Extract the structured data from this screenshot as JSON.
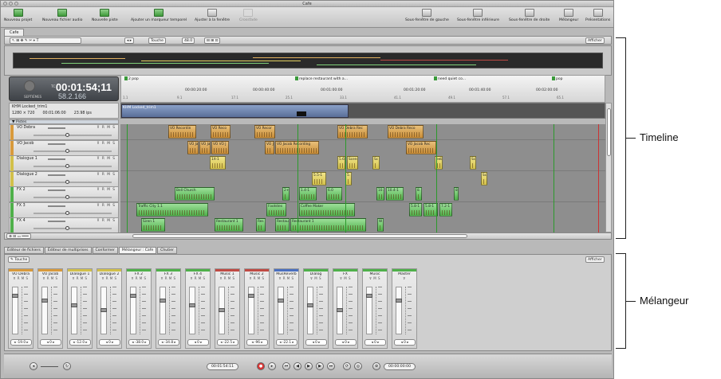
{
  "window": {
    "title": "Cafe"
  },
  "toolbar": {
    "buttons": [
      "Nouveau projet",
      "Nouveau fichier audio",
      "Nouvelle piste",
      "Ajouter un marqueur temporel",
      "Ajuster à la fenêtre",
      "Crossfade"
    ],
    "right_buttons": [
      "Sous-fenêtre de gauche",
      "Sous-fenêtre inférieure",
      "Sous-fenêtre de droite",
      "Mélangeur",
      "Présentations"
    ]
  },
  "project_tab": "Cafe",
  "project_toolbar": {
    "mode": "Touche",
    "zoom": "48.0",
    "afficher": "Afficher"
  },
  "timecode": {
    "tc_label": "TC",
    "main": "00:01:54;11",
    "sub_label": "SEPTIÈMES",
    "sub": "58.2.166"
  },
  "markers": [
    "2 pop",
    "replace restaurant with a...",
    "need quiet co...",
    "pop"
  ],
  "ruler_ticks": [
    "00:00:20:00",
    "00:00:40:00",
    "00:01:00:00",
    "00:01:20:00",
    "00:01:40:00",
    "00:02:00:00"
  ],
  "ruler_ticks2": [
    "1.1",
    "9.1",
    "17.1",
    "25.1",
    "33.1",
    "41.1",
    "49.1",
    "57.1",
    "65.1"
  ],
  "video": {
    "name": "KHM Locked_trim1",
    "size": "1280 × 720",
    "duration": "00:01:06:00",
    "fps": "23.98 ips",
    "clip": "KHM Locked_trim1"
  },
  "pistes_label": "Pistes",
  "tracks": [
    {
      "name": "VO Debra",
      "color": "#d89a3c",
      "clips": [
        [
          "VO Recordin",
          "o",
          60,
          35
        ],
        [
          "VO Reco",
          "o",
          113,
          25
        ],
        [
          "VO Recor",
          "o",
          168,
          26
        ],
        [
          "VO Debra Rec",
          "o",
          272,
          38
        ],
        [
          "VO Debra Reco",
          "o",
          335,
          45
        ]
      ]
    },
    {
      "name": "VO Jacob",
      "color": "#d89a3c",
      "clips": [
        [
          "VO Jac",
          "o",
          84,
          14
        ],
        [
          "VO Jac",
          "o",
          99,
          14
        ],
        [
          "VO VO J",
          "o",
          114,
          22
        ],
        [
          "VO J",
          "o",
          181,
          12
        ],
        [
          "VO Jacob Recording",
          "o",
          194,
          55
        ],
        [
          "VO Jacob Rec",
          "o",
          358,
          38
        ]
      ]
    },
    {
      "name": "Dialogue 1",
      "color": "#d2c04a",
      "clips": [
        [
          "1X-1",
          "y",
          112,
          20
        ],
        [
          "5.6-1",
          "y",
          272,
          10
        ],
        [
          "Scene",
          "y",
          284,
          14
        ],
        [
          "Sc",
          "y",
          316,
          9
        ],
        [
          "eeb",
          "y",
          394,
          10
        ],
        [
          "Sc",
          "y",
          438,
          8
        ]
      ]
    },
    {
      "name": "Dialogue 2",
      "color": "#d2c04a",
      "clips": [
        [
          "5.5-1",
          "y",
          240,
          18
        ],
        [
          "5.",
          "y",
          282,
          8
        ],
        [
          "Sc",
          "y",
          452,
          8
        ]
      ]
    },
    {
      "name": "FX 2",
      "color": "#4fb04a",
      "clips": [
        [
          "Bell Church",
          "g",
          68,
          50
        ],
        [
          "2+",
          "g",
          203,
          9
        ],
        [
          "1.4-1",
          "g",
          224,
          22
        ],
        [
          "6.0",
          "g",
          258,
          20
        ],
        [
          "10.4",
          "g",
          321,
          10
        ],
        [
          "10.4-1",
          "g",
          333,
          22
        ],
        [
          "8.",
          "g",
          370,
          8
        ],
        [
          "8.",
          "g",
          418,
          6
        ]
      ]
    },
    {
      "name": "FX 3",
      "color": "#4fb04a",
      "clips": [
        [
          "Traffic City 1.1",
          "g",
          20,
          90
        ],
        [
          "Footstes",
          "g",
          183,
          25
        ],
        [
          "Coffee Maker",
          "g",
          224,
          70
        ],
        [
          "5.8-1",
          "g",
          362,
          16
        ],
        [
          "5.8-1",
          "g",
          380,
          18
        ],
        [
          "7.2-1",
          "g",
          400,
          16
        ]
      ]
    },
    {
      "name": "FX 4",
      "color": "#4fb04a",
      "clips": [
        [
          "Siren 1",
          "g",
          26,
          30
        ],
        [
          "Restaurant 1",
          "g",
          118,
          36
        ],
        [
          "Res",
          "g",
          170,
          12
        ],
        [
          "Restau",
          "g",
          194,
          18
        ],
        [
          "Restaurant 1",
          "g",
          213,
          95
        ],
        [
          "W",
          "g",
          322,
          8
        ]
      ]
    }
  ],
  "bottom_tabs": [
    "Éditeur de fichiers",
    "Éditeur de multiprises",
    "Conformer",
    "Mélangeur : Cafe",
    "Chutier"
  ],
  "mixer": {
    "mode": "Touche",
    "afficher": "Afficher",
    "strips": [
      {
        "name": "VO Debra",
        "color": "#d89a3c",
        "buttons": "R M S",
        "value": "-19.0"
      },
      {
        "name": "VO Jacob",
        "color": "#d89a3c",
        "buttons": "R M S",
        "value": "0"
      },
      {
        "name": "Dialogue 1",
        "color": "#d2c04a",
        "buttons": "R M S",
        "value": "-12.0"
      },
      {
        "name": "Dialogue 2",
        "color": "#d2c04a",
        "buttons": "R M S",
        "value": "0"
      },
      {
        "name": "FX 2",
        "color": "#4fb04a",
        "buttons": "R M S",
        "value": "-38.0"
      },
      {
        "name": "FX 3",
        "color": "#4fb04a",
        "buttons": "R M S",
        "value": "-34.8"
      },
      {
        "name": "FX 4",
        "color": "#4fb04a",
        "buttons": "R M S",
        "value": "0"
      },
      {
        "name": "Music 1",
        "color": "#c04a44",
        "buttons": "R M S",
        "value": "-22.5"
      },
      {
        "name": "Music 2",
        "color": "#c04a44",
        "buttons": "R M S",
        "value": "-96"
      },
      {
        "name": "MusReverb",
        "color": "#4a70c0",
        "buttons": "R M S",
        "value": "-22.1"
      },
      {
        "name": "Dialog",
        "color": "#4fb04a",
        "buttons": "M S",
        "value": "0"
      },
      {
        "name": "FX",
        "color": "#4fb04a",
        "buttons": "M S",
        "value": "0"
      },
      {
        "name": "Music",
        "color": "#4fb04a",
        "buttons": "M S",
        "value": "0"
      },
      {
        "name": "Master",
        "color": "#4fb04a",
        "buttons": "",
        "value": "0"
      }
    ]
  },
  "transport": {
    "playhead_tc": "00:01:54:11",
    "end_tc": "00:00:00:00"
  },
  "annotations": {
    "timeline": "Timeline",
    "mixer": "Mélangeur"
  }
}
